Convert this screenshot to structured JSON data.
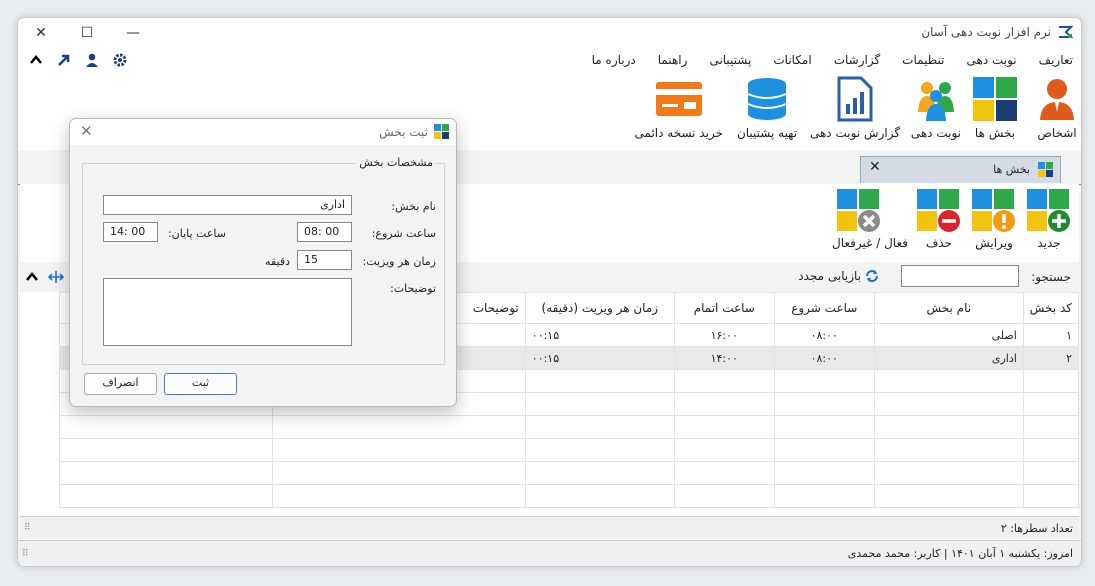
{
  "app": {
    "title": "نرم افزار نوبت دهی آسان"
  },
  "menu": {
    "items": [
      "تعاریف",
      "نوبت دهی",
      "تنظیمات",
      "گزارشات",
      "امکانات",
      "پشتیبانی",
      "راهنما",
      "درباره ما"
    ]
  },
  "toolbar": {
    "persons": "اشخاص",
    "sections": "بخش ها",
    "appointments": "نوبت دهی",
    "report": "گزارش نوبت دهی",
    "backup": "تهیه پشتیبان",
    "buy": "خرید نسخه دائمی"
  },
  "doc_tab": {
    "label": "بخش ها"
  },
  "actions": {
    "new": "جدید",
    "edit": "ویرایش",
    "delete": "حذف",
    "toggle": "فعال / غیرفعال"
  },
  "search": {
    "label": "جستجو:",
    "value": "",
    "refresh": "بازیابی مجدد"
  },
  "table": {
    "headers": [
      "کد بخش",
      "نام بخش",
      "ساعت شروع",
      "ساعت اتمام",
      "زمان هر ویزیت (دقیقه)",
      "توضیحات"
    ],
    "rows": [
      [
        "۱",
        "اصلی",
        "۰۸:۰۰",
        "۱۶:۰۰",
        "۰۰:۱۵",
        ""
      ],
      [
        "۲",
        "اداری",
        "۰۸:۰۰",
        "۱۴:۰۰",
        "۰۰:۱۵",
        ""
      ]
    ]
  },
  "footer": {
    "row_count": "تعداد سطرها:  ۲"
  },
  "status": {
    "text": "امروز: یکشنبه ۱ آبان ۱۴۰۱   |   کاربر: محمد محمدی"
  },
  "dialog": {
    "title": "ثبت بخش",
    "group_title": "مشخصات بخش",
    "name_label": "نام بخش:",
    "name_value": "اداری",
    "start_label": "ساعت شروع:",
    "start_value": "08: 00",
    "end_label": "ساعت پایان:",
    "end_value": "14: 00",
    "visit_label": "زمان هر ویزیت:",
    "visit_value": "15",
    "visit_unit": "دقیقه",
    "desc_label": "توضیحات:",
    "desc_value": "",
    "submit": "ثبت",
    "cancel": "انصراف"
  }
}
